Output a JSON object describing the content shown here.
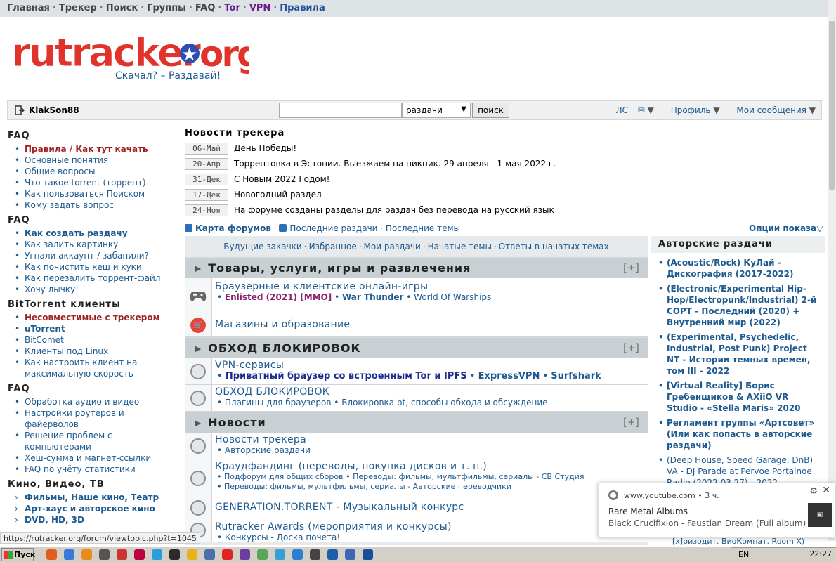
{
  "topnav": {
    "items": [
      {
        "label": "Главная",
        "style": "it"
      },
      {
        "label": "Трекер",
        "style": "it"
      },
      {
        "label": "Поиск",
        "style": "it"
      },
      {
        "label": "Группы",
        "style": "it"
      },
      {
        "label": "FAQ",
        "style": "it"
      },
      {
        "label": "Tor",
        "style": "purple"
      },
      {
        "label": "VPN",
        "style": "purple"
      },
      {
        "label": "Правила",
        "style": "blue"
      }
    ],
    "separator": "·"
  },
  "logo": {
    "text": "rutracker.org",
    "slogan": "Скачал? – Раздавай!"
  },
  "userbar": {
    "username": "KlakSon88",
    "search_select": "раздачи",
    "search_button": "поиск",
    "menu_pm": "ЛС",
    "menu_profile": "Профиль",
    "menu_messages": "Мои сообщения"
  },
  "sidebar": {
    "sections": [
      {
        "title": "FAQ",
        "items": [
          {
            "label": "Правила / Как тут качать",
            "style": "red"
          },
          {
            "label": "Основные понятия"
          },
          {
            "label": "Общие вопросы"
          },
          {
            "label": "Что такое torrent (торрент)"
          },
          {
            "label": "Как пользоваться Поиском"
          },
          {
            "label": "Кому задать вопрос"
          }
        ]
      },
      {
        "title": "FAQ",
        "items": [
          {
            "label": "Как создать раздачу",
            "style": "bold"
          },
          {
            "label": "Как залить картинку"
          },
          {
            "label": "Угнали аккаунт / забанили?"
          },
          {
            "label": "Как почистить кеш и куки"
          },
          {
            "label": "Как перезалить торрент-файл"
          },
          {
            "label": "Хочу лычку!"
          }
        ]
      },
      {
        "title": "BitTorrent клиенты",
        "items": [
          {
            "label": "Несовместимые с трекером",
            "style": "red"
          },
          {
            "label": "uTorrent",
            "style": "bold"
          },
          {
            "label": "BitComet"
          },
          {
            "label": "Клиенты под Linux"
          },
          {
            "label": "Как настроить клиент на максимальную скорость"
          }
        ]
      },
      {
        "title": "FAQ",
        "items": [
          {
            "label": "Обработка аудио и видео"
          },
          {
            "label": "Настройки роутеров и файерволов"
          },
          {
            "label": "Решение проблем с компьютерами"
          },
          {
            "label": "Хеш-сумма и магнет-ссылки"
          },
          {
            "label": "FAQ по учёту статистики"
          }
        ]
      },
      {
        "title": "Кино, Видео, ТВ",
        "items": [
          {
            "label": "Фильмы, Наше кино, Театр",
            "style": "bold"
          },
          {
            "label": "Арт-хаус и авторское кино",
            "style": "bold"
          },
          {
            "label": "DVD, HD, 3D",
            "style": "bold"
          }
        ]
      }
    ]
  },
  "news": {
    "title": "Новости трекера",
    "rows": [
      {
        "date": "06-Май",
        "text": "День Победы!"
      },
      {
        "date": "20-Апр",
        "text": "Торрентовка в Эстонии. Выезжаем на пикник. 29 апреля - 1 мая 2022 г."
      },
      {
        "date": "31-Дек",
        "text": "С Новым 2022 Годом!"
      },
      {
        "date": "17-Дек",
        "text": "Новогодний раздел"
      },
      {
        "date": "24-Ноя",
        "text": "На форуме созданы разделы для раздач без перевода на русский язык"
      }
    ]
  },
  "forumlinks": {
    "map": "Карта форумов",
    "latest": "Последние раздачи",
    "topics": "Последние темы",
    "display": "Опции показа"
  },
  "subnav": [
    "Будущие закачки",
    "Избранное",
    "Мои раздачи",
    "Начатые темы",
    "Ответы в начатых темах"
  ],
  "categories": [
    {
      "title": "Товары, услуги, игры и развлечения",
      "plus": "[+]"
    },
    {
      "title": "ОБХОД БЛОКИРОВОК",
      "plus": "[+]"
    },
    {
      "title": "Новости",
      "plus": "[+]"
    }
  ],
  "forums": {
    "games": {
      "title": "Браузерные и клиентские онлайн-игры",
      "sub1": "Enlisted (2021) [MMO]",
      "sub2": "War Thunder",
      "sub3": "World Of Warships"
    },
    "shops": {
      "title": "Магазины и образование"
    },
    "vpn": {
      "title": "VPN-сервисы",
      "sub1": "Приватный браузер со встроенным Tor и IPFS",
      "sub2": "ExpressVPN",
      "sub3": "Surfshark"
    },
    "bypass": {
      "title": "ОБХОД БЛОКИРОВОК",
      "sub1": "Плагины для браузеров",
      "sub2": "Блокировка bt, способы обхода и обсуждение"
    },
    "trackernews": {
      "title": "Новости трекера",
      "sub1": "Авторские раздачи"
    },
    "crowd": {
      "title": "Краудфандинг (переводы, покупка дисков и т. п.)",
      "sub1": "Подфорум для общих сборов",
      "sub2": "Переводы: фильмы, мультфильмы, сериалы - СВ Студия",
      "sub3": "Переводы: фильмы, мультфильмы, сериалы - Авторские переводчики"
    },
    "generation": {
      "title": "GENERATION.TORRENT - Музыкальный конкурс"
    },
    "awards": {
      "title": "Rutracker Awards (мероприятия и конкурсы)",
      "sub1": "Конкурсы - Доска почета!"
    }
  },
  "author": {
    "title": "Авторские раздачи",
    "items": [
      {
        "label": "(Acoustic/Rock) КуЛай - Дискография (2017-2022)"
      },
      {
        "label": "(Electronic/Experimental Hip-Hop/Electropunk/Industrial) 2-й СОРТ - Последний (2020) + Внутренний мир (2022)"
      },
      {
        "label": "(Experimental, Psychedelic, Industrial, Post Punk) Project NT - Истории темных времен, том III - 2022"
      },
      {
        "label": "[Virtual Reality] Борис Гребенщиков & AXiiO VR Studio - «Stella Maris» 2020"
      },
      {
        "label": "Регламент группы «Артсовет» (Или как попасть в авторские раздачи)"
      },
      {
        "label": "(Deep House, Speed Garage, DnB) VA - DJ Parade at Pervoe Portalnoe Radio (2022.03.27) - 2022",
        "style": "nb"
      }
    ],
    "footer": "[х]ризодит. ВиоКомпат. Room X)"
  },
  "notification": {
    "source": "www.youtube.com",
    "age": "3 ч.",
    "title": "Rare Metal Albums",
    "body": "Black Crucifixion - Faustian Dream (Full album)"
  },
  "status_url": "https://rutracker.org/forum/viewtopic.php?t=1045",
  "taskbar": {
    "start": "Пуск",
    "lang": "EN",
    "clock": "22:27"
  }
}
